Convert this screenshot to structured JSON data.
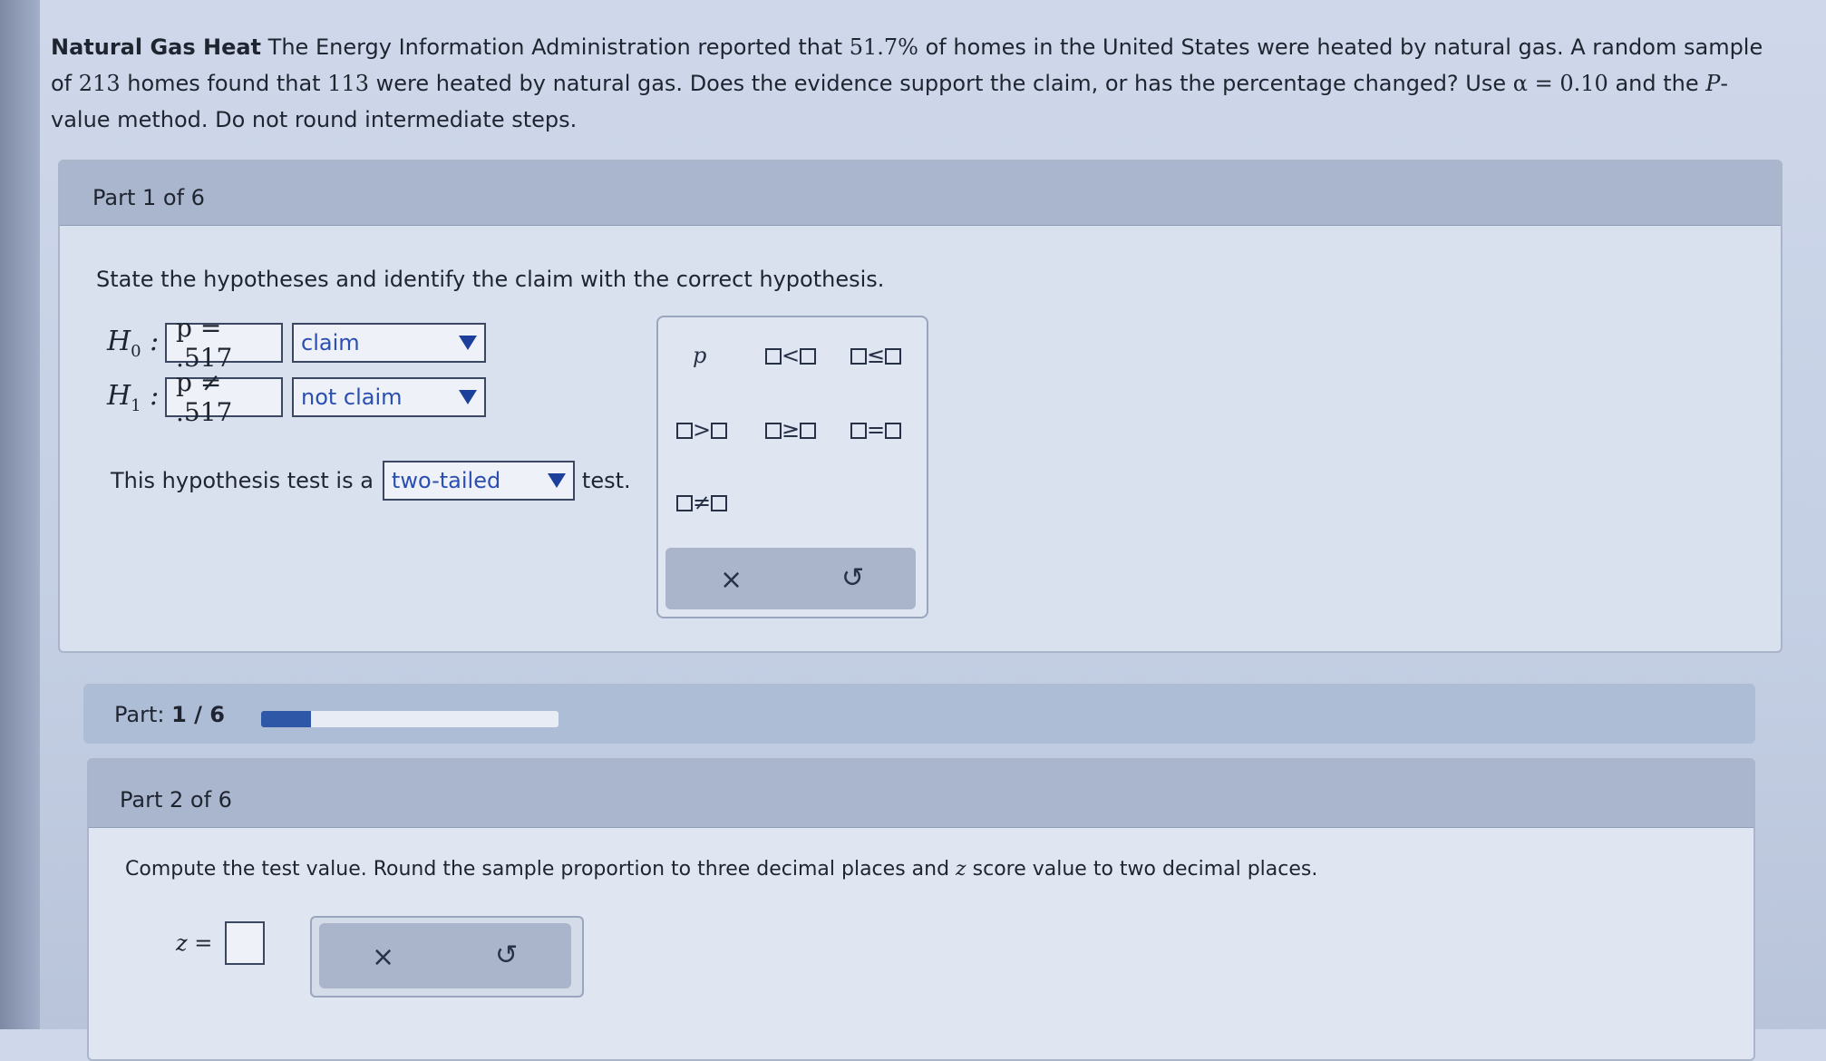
{
  "problem": {
    "title": "Natural Gas Heat",
    "text_a": "The Energy Information Administration reported that",
    "pct": "51.7%",
    "text_b": "of homes in the United States were heated by natural gas. A random sample of",
    "n": "213",
    "text_c": "homes found that",
    "x": "113",
    "text_d": "were heated by natural gas. Does the evidence support the claim, or has the percentage changed? Use",
    "alpha": "α = 0.10",
    "text_e": "and the",
    "pv": "P",
    "text_f": "-value method. Do not round intermediate steps."
  },
  "part1": {
    "title": "Part 1 of 6",
    "instruction": "State the hypotheses and identify the claim with the correct hypothesis.",
    "h0": {
      "label": "H",
      "sub": "0",
      "expr": "p = .517",
      "select": "claim"
    },
    "h1": {
      "label": "H",
      "sub": "1",
      "expr": "p ≠ .517",
      "select": "not claim"
    },
    "test_prefix": "This hypothesis test is a",
    "test_value": "two-tailed",
    "test_suffix": "test."
  },
  "palette": {
    "p": "p",
    "lt": "<",
    "le": "≤",
    "gt": ">",
    "ge": "≥",
    "eq": "=",
    "ne": "≠",
    "clear": "×",
    "undo": "↺"
  },
  "progress": {
    "label": "Part:",
    "value": "1 / 6",
    "fraction": 0.167
  },
  "part2": {
    "title": "Part 2 of 6",
    "instruction_a": "Compute the test value. Round the sample proportion to three decimal places and",
    "instruction_z": "z",
    "instruction_b": "score value to two decimal places.",
    "z_label": "z =",
    "clear": "×",
    "undo": "↺"
  }
}
